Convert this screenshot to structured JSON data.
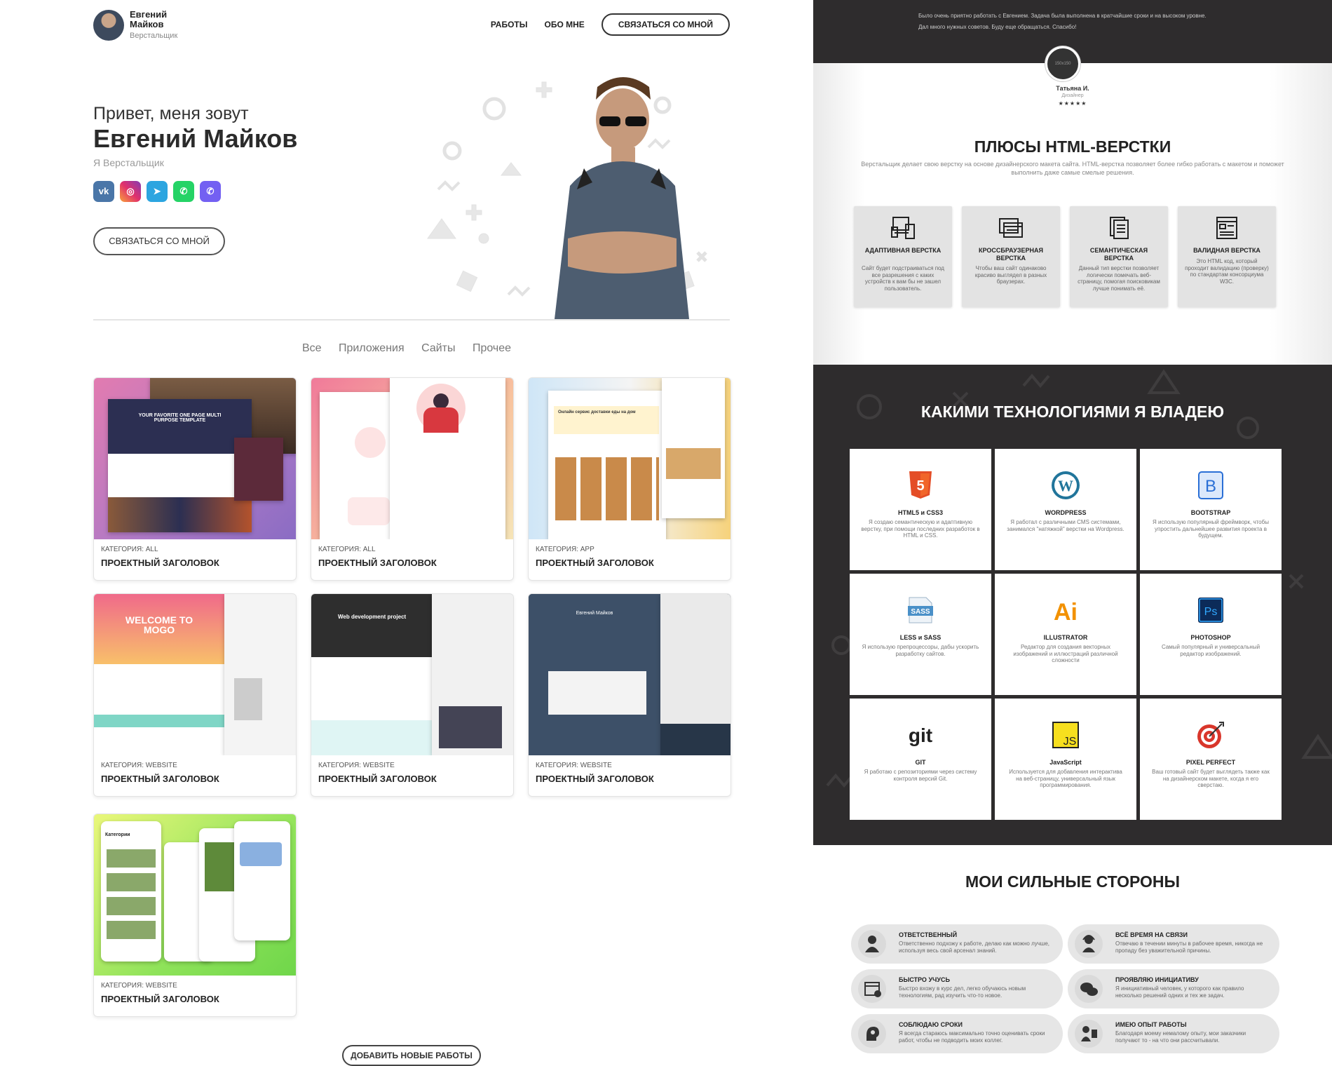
{
  "header": {
    "name": "Евгений Майков",
    "role": "Верстальщик",
    "nav": [
      "РАБОТЫ",
      "ОБО МНЕ"
    ],
    "contact_btn": "СВЯЗАТЬСЯ СО МНОЙ"
  },
  "hero": {
    "greeting": "Привет, меня зовут",
    "name": "Евгений Майков",
    "role": "Я Верстальщик",
    "socials": [
      {
        "icon": "vk-icon",
        "glyph": "vk",
        "color": "#4a76a8"
      },
      {
        "icon": "instagram-icon",
        "glyph": "◎",
        "color": "#d6249f"
      },
      {
        "icon": "telegram-icon",
        "glyph": "➤",
        "color": "#2ca5e0"
      },
      {
        "icon": "whatsapp-icon",
        "glyph": "✆",
        "color": "#25d366"
      },
      {
        "icon": "viber-icon",
        "glyph": "✆",
        "color": "#7360f2"
      }
    ],
    "button": "СВЯЗАТЬСЯ СО МНОЙ"
  },
  "filters": [
    "Все",
    "Приложения",
    "Сайты",
    "Прочее"
  ],
  "works": [
    {
      "category": "КАТЕГОРИЯ: ALL",
      "title": "ПРОЕКТНЫЙ ЗАГОЛОВОК",
      "inner_text": "YOUR FAVORITE ONE PAGE MULTI PURPOSE TEMPLATE"
    },
    {
      "category": "КАТЕГОРИЯ: ALL",
      "title": "ПРОЕКТНЫЙ ЗАГОЛОВОК"
    },
    {
      "category": "КАТЕГОРИЯ: APP",
      "title": "ПРОЕКТНЫЙ ЗАГОЛОВОК",
      "inner_text": "Онлайн сервис доставки еды на дом"
    },
    {
      "category": "КАТЕГОРИЯ: WEBSITE",
      "title": "ПРОЕКТНЫЙ ЗАГОЛОВОК",
      "inner_text": "WELCOME TO MOGO"
    },
    {
      "category": "КАТЕГОРИЯ: WEBSITE",
      "title": "ПРОЕКТНЫЙ ЗАГОЛОВОК",
      "inner_text": "Web development project"
    },
    {
      "category": "КАТЕГОРИЯ: WEBSITE",
      "title": "ПРОЕКТНЫЙ ЗАГОЛОВОК",
      "inner_text": "Евгений Майков"
    },
    {
      "category": "КАТЕГОРИЯ: WEBSITE",
      "title": "ПРОЕКТНЫЙ ЗАГОЛОВОК",
      "inner_text": "Категории"
    }
  ],
  "add_button": "ДОБАВИТЬ НОВЫЕ РАБОТЫ",
  "review": {
    "text1": "Было очень приятно работать с Евгением. Задача была выполнена в кратчайшие сроки и на высоком уровне.",
    "text2": "Дал много нужных советов. Буду еще обращаться. Спасибо!",
    "avatar_text": "150x150",
    "name": "Татьяна И.",
    "role": "Дизайнер",
    "stars": "★★★★★"
  },
  "plus": {
    "title": "ПЛЮСЫ HTML-ВЕРСТКИ",
    "desc": "Верстальщик делает свою верстку на основе дизайнерского макета сайта. HTML-верстка позволяет более гибко работать с макетом и поможет выполнить даже самые смелые решения.",
    "items": [
      {
        "icon": "devices-icon",
        "title": "АДАПТИВНАЯ ВЕРСТКА",
        "desc": "Сайт будет подстраиваться под все разрешения с каких устройств к вам бы не зашел пользователь."
      },
      {
        "icon": "browsers-icon",
        "title": "КРОССБРАУЗЕРНАЯ ВЕРСТКА",
        "desc": "Чтобы ваш сайт одинаково красиво выглядел в разных браузерах."
      },
      {
        "icon": "document-icon",
        "title": "СЕМАНТИЧЕСКАЯ ВЕРСТКА",
        "desc": "Данный тип верстки позволяет логически помечать веб-страницу, помогая поисковикам лучше понимать её."
      },
      {
        "icon": "validation-icon",
        "title": "ВАЛИДНАЯ ВЕРСТКА",
        "desc": "Это HTML код, который проходит валидацию (проверку) по стандартам консорциума W3C."
      }
    ]
  },
  "tech": {
    "title": "КАКИМИ ТЕХНОЛОГИЯМИ Я ВЛАДЕЮ",
    "items": [
      {
        "icon": "html5-icon",
        "glyph": "5",
        "color": "#e44d26",
        "title": "HTML5 и CSS3",
        "desc": "Я создаю семантическую и адаптивную верстку, при помощи последних разработок в HTML и CSS."
      },
      {
        "icon": "wordpress-icon",
        "glyph": "W",
        "color": "#21759b",
        "title": "WORDPRESS",
        "desc": "Я работал с различными CMS системами, занимался \"натяжкой\" верстки на Wordpress."
      },
      {
        "icon": "bootstrap-icon",
        "glyph": "B",
        "color": "#2a6fd6",
        "title": "BOOTSTRAP",
        "desc": "Я использую популярный фреймворк, чтобы упростить дальнейшее развития проекта в будущем."
      },
      {
        "icon": "sass-icon",
        "glyph": "SASS",
        "color": "#4a90c8",
        "title": "LESS и SASS",
        "desc": "Я использую препроцессоры, дабы ускорить разработку сайтов."
      },
      {
        "icon": "illustrator-icon",
        "glyph": "Ai",
        "color": "#f29100",
        "title": "ILLUSTRATOR",
        "desc": "Редактор для создания векторных изображений и иллюстраций различной сложности"
      },
      {
        "icon": "photoshop-icon",
        "glyph": "Ps",
        "color": "#1473e6",
        "title": "PHOTOSHOP",
        "desc": "Самый популярный и универсальный редактор изображений."
      },
      {
        "icon": "git-icon",
        "glyph": "git",
        "color": "#222222",
        "title": "GIT",
        "desc": "Я работаю с репозиториями через систему контроля версий Git."
      },
      {
        "icon": "javascript-icon",
        "glyph": "JS",
        "color": "#f7df1e",
        "title": "JavaScript",
        "desc": "Используется для добавления интерактива на веб-страницу, универсальный язык программирования."
      },
      {
        "icon": "target-icon",
        "glyph": "◎",
        "color": "#d9362b",
        "title": "PIXEL PERFECT",
        "desc": "Ваш готовый сайт будет выглядеть также как на дизайнерском макете, когда я его сверстаю."
      }
    ]
  },
  "strengths": {
    "title": "МОИ СИЛЬНЫЕ СТОРОНЫ",
    "items": [
      {
        "icon": "person-icon",
        "glyph": "👤",
        "title": "ОТВЕТСТВЕННЫЙ",
        "desc": "Ответственно подхожу к работе, делаю как можно лучше, используя весь свой арсенал знаний."
      },
      {
        "icon": "support-icon",
        "glyph": "☎",
        "title": "ВСЁ ВРЕМЯ НА СВЯЗИ",
        "desc": "Отвечаю в течении минуты в рабочее время, никогда не пропаду без уважительной причины."
      },
      {
        "icon": "calendar-icon",
        "glyph": "▦",
        "title": "БЫСТРО УЧУСЬ",
        "desc": "Быстро вхожу в курс дел, легко обучаюсь новым технологиям, рад изучить что-то новое."
      },
      {
        "icon": "chat-icon",
        "glyph": "✉",
        "title": "ПРОЯВЛЯЮ ИНИЦИАТИВУ",
        "desc": "Я инициативный человек, у которого как правило несколько решений одних и тех же задач."
      },
      {
        "icon": "head-bulb-icon",
        "glyph": "☀",
        "title": "СОБЛЮДАЮ СРОКИ",
        "desc": "Я всегда стараюсь максимально точно оценивать сроки работ, чтобы не подводить моих коллег."
      },
      {
        "icon": "experience-icon",
        "glyph": "★",
        "title": "ИМЕЮ ОПЫТ РАБОТЫ",
        "desc": "Благодаря моему немалому опыту, мои заказчики получают то - на что они рассчитывали."
      }
    ]
  }
}
